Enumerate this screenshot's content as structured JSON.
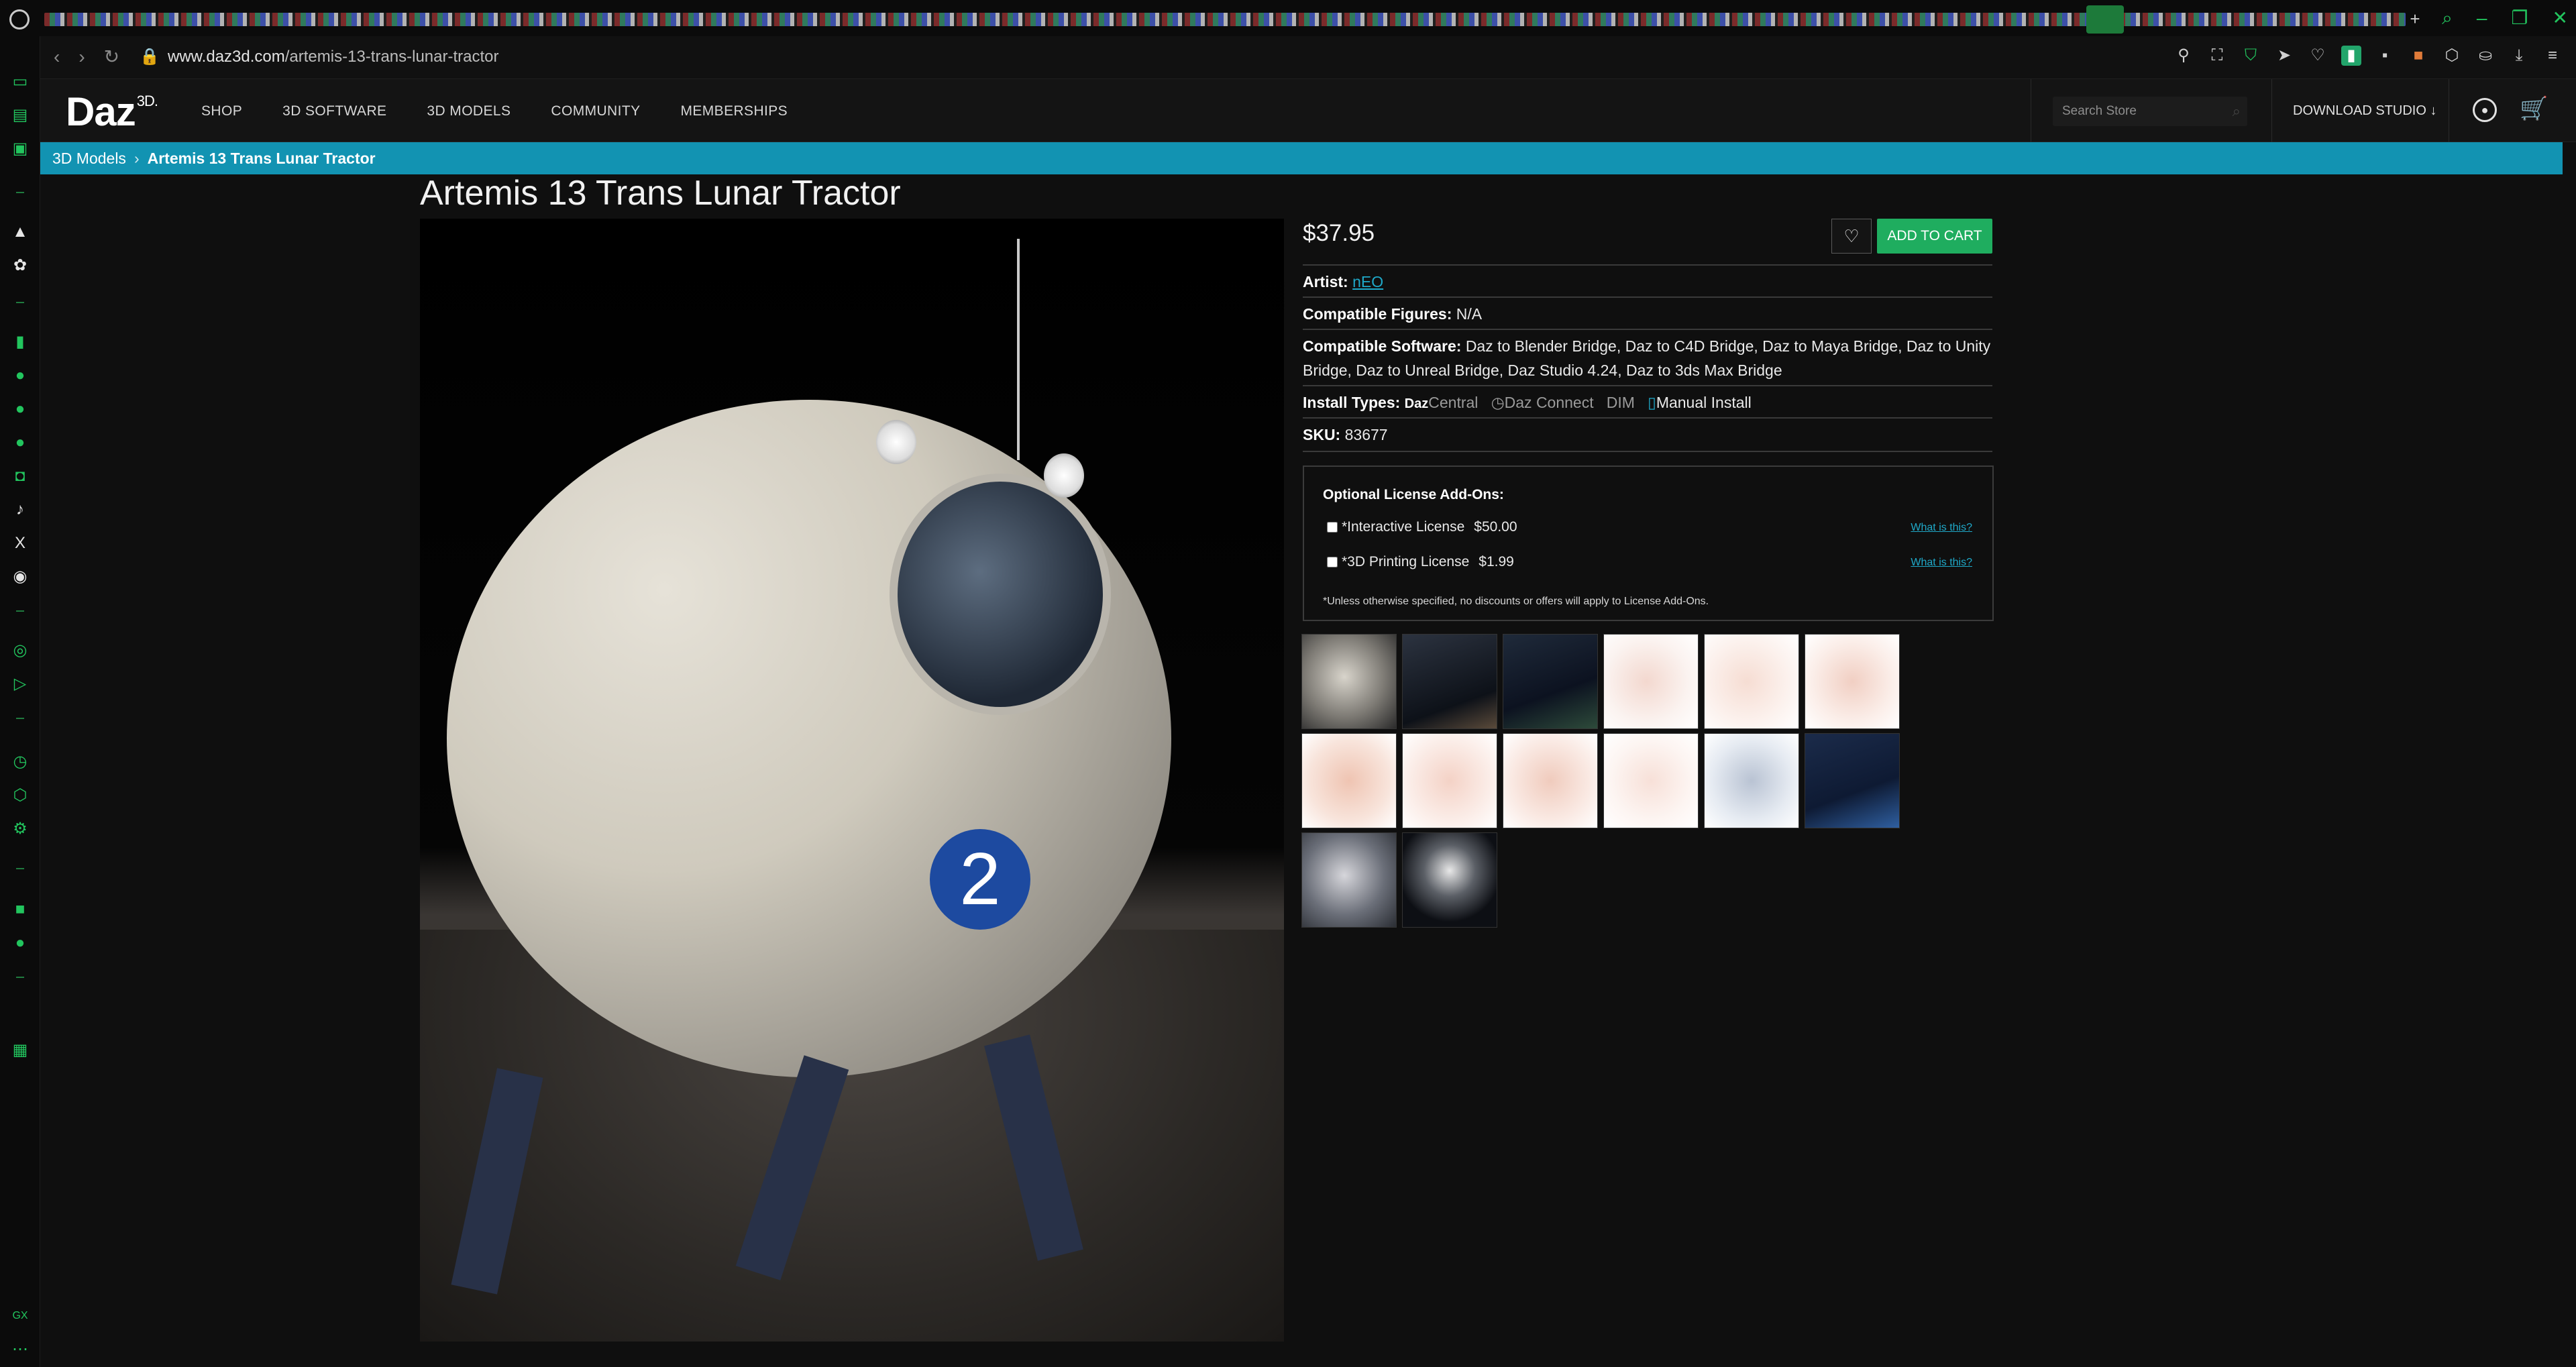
{
  "browser": {
    "url_host": "www.daz3d.com",
    "url_path": "/artemis-13-trans-lunar-tractor"
  },
  "site": {
    "logo": "Daz",
    "logo_sup": "3D.",
    "nav": [
      "SHOP",
      "3D SOFTWARE",
      "3D MODELS",
      "COMMUNITY",
      "MEMBERSHIPS"
    ],
    "search_placeholder": "Search Store",
    "download_label": "DOWNLOAD STUDIO"
  },
  "breadcrumb": {
    "parent": "3D Models",
    "separator": "›",
    "current": "Artemis 13 Trans Lunar Tractor"
  },
  "product": {
    "title": "Artemis 13 Trans Lunar Tractor",
    "price": "$37.95",
    "add_to_cart": "ADD TO CART",
    "artist_label": "Artist:",
    "artist": "nEO",
    "figures_label": "Compatible Figures:",
    "figures": "N/A",
    "software_label": "Compatible Software:",
    "software_line1": "Daz to Blender Bridge, Daz to C4D Bridge, Daz to Maya Bridge, Daz to Unity",
    "software_line2": "Bridge, Daz to Unreal Bridge, Daz Studio 4.24, Daz to 3ds Max Bridge",
    "install_label": "Install Types:",
    "install_daz": "Daz",
    "install_central": "Central",
    "install_connect": "Daz Connect",
    "install_dim": "DIM",
    "install_manual": "Manual Install",
    "sku_label": "SKU:",
    "sku": "83677"
  },
  "addons": {
    "heading": "Optional License Add-Ons:",
    "items": [
      {
        "label": "*Interactive License",
        "price": "$50.00",
        "help": "What is this?"
      },
      {
        "label": "*3D Printing License",
        "price": "$1.99",
        "help": "What is this?"
      }
    ],
    "note": "*Unless otherwise specified, no discounts or offers will apply to License Add-Ons."
  },
  "hero_badge": "2",
  "colors": {
    "accent_teal": "#1293b2",
    "cart_green": "#1fad5f",
    "link_blue": "#1fa9c9",
    "gx_green": "#22c55e"
  }
}
